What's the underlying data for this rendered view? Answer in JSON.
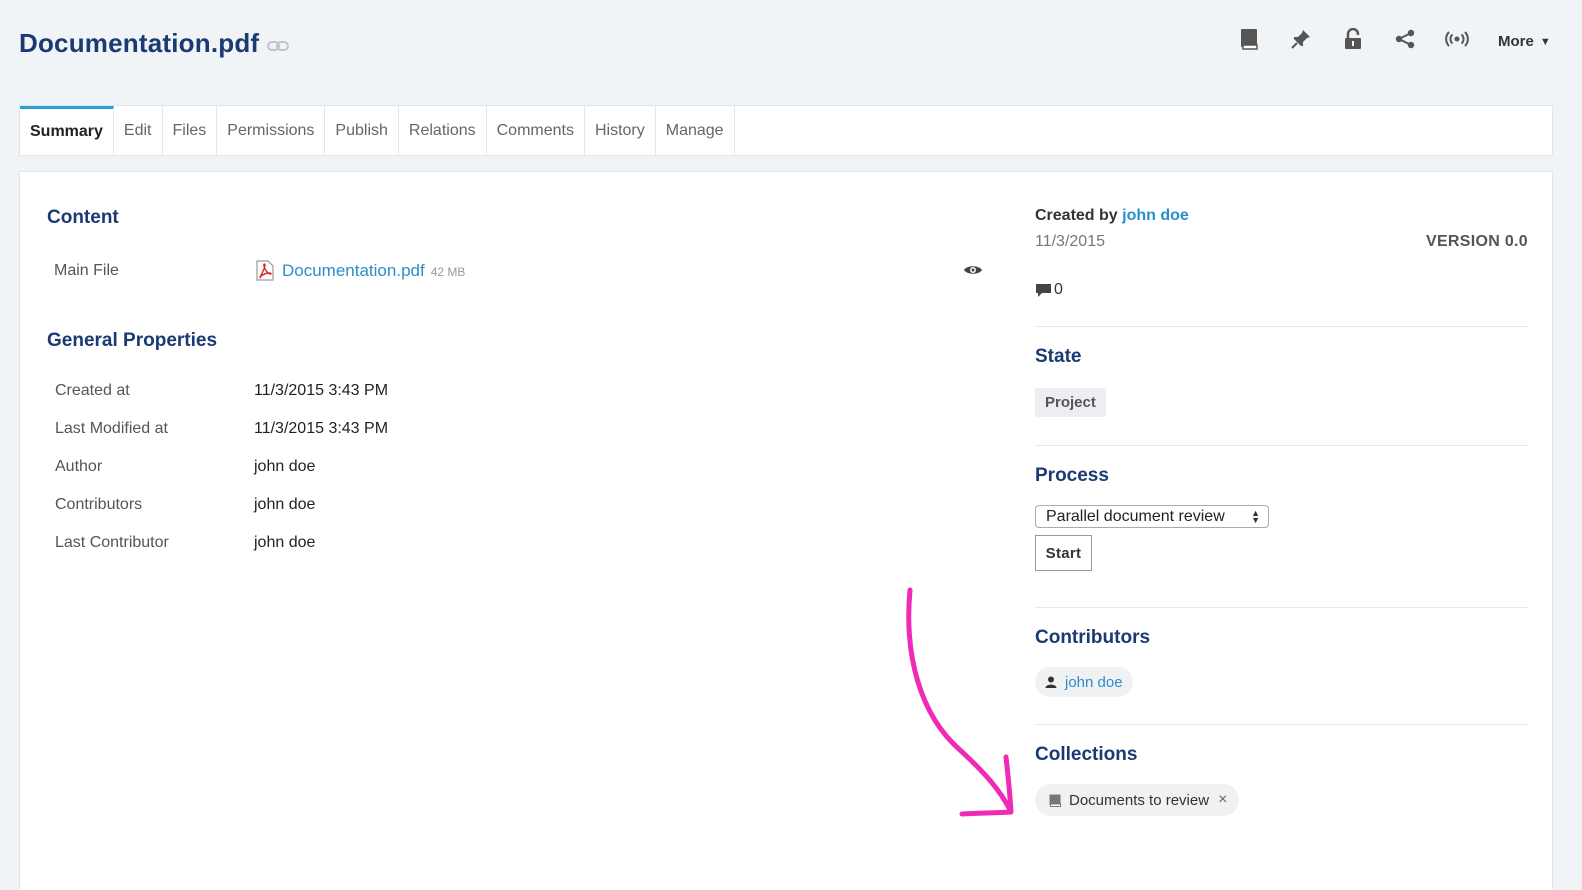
{
  "header": {
    "title": "Documentation.pdf",
    "more_label": "More"
  },
  "icons": {
    "link": "link-icon",
    "book": "book-icon",
    "pin": "pin-icon",
    "lock": "unlock-icon",
    "share": "share-icon",
    "broadcast": "broadcast-icon",
    "pdf": "pdf-icon",
    "eye": "eye-icon",
    "comment": "comment-icon",
    "user": "user-icon",
    "collection": "collection-icon"
  },
  "tabs": [
    {
      "label": "Summary"
    },
    {
      "label": "Edit"
    },
    {
      "label": "Files"
    },
    {
      "label": "Permissions"
    },
    {
      "label": "Publish"
    },
    {
      "label": "Relations"
    },
    {
      "label": "Comments"
    },
    {
      "label": "History"
    },
    {
      "label": "Manage"
    }
  ],
  "content": {
    "title": "Content",
    "main_file_label": "Main File",
    "file_name": "Documentation.pdf",
    "file_size": "42 MB"
  },
  "general": {
    "title": "General Properties",
    "rows": [
      {
        "label": "Created at",
        "value": "11/3/2015 3:43 PM"
      },
      {
        "label": "Last Modified at",
        "value": "11/3/2015 3:43 PM"
      },
      {
        "label": "Author",
        "value": "john doe"
      },
      {
        "label": "Contributors",
        "value": "john doe"
      },
      {
        "label": "Last Contributor",
        "value": "john doe"
      }
    ]
  },
  "sidebar": {
    "created_by_label": "Created by",
    "created_by_user": "john doe",
    "created_date": "11/3/2015",
    "version": "VERSION 0.0",
    "comment_count": "0",
    "state_title": "State",
    "state_value": "Project",
    "process_title": "Process",
    "process_selected": "Parallel document review",
    "start_label": "Start",
    "contributors_title": "Contributors",
    "contributor": "john doe",
    "collections_title": "Collections",
    "collection": "Documents to review",
    "remove_symbol": "×"
  },
  "colors": {
    "title": "#1b3a73",
    "link": "#2a8fc9",
    "active_tab_accent": "#2a9fd8",
    "annotation_arrow": "#ee2ab6"
  }
}
